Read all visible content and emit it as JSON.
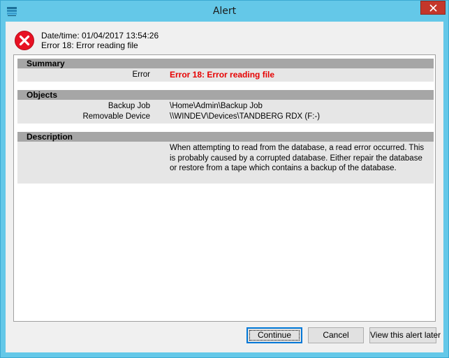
{
  "window": {
    "title": "Alert"
  },
  "icons": {
    "app": "app-icon",
    "close": "close-icon",
    "error": "error-icon"
  },
  "colors": {
    "titlebar": "#64c8e8",
    "close_button": "#c4372b",
    "error_red": "#e60000",
    "section_header": "#a6a6a6",
    "section_body": "#e6e6e6"
  },
  "header": {
    "datetime_line": "Date/time: 01/04/2017 13:54:26",
    "error_line": "Error 18: Error reading file"
  },
  "summary": {
    "title": "Summary",
    "rows": [
      {
        "label": "Error",
        "value": "Error 18: Error reading file"
      }
    ]
  },
  "objects": {
    "title": "Objects",
    "rows": [
      {
        "label": "Backup Job",
        "value": "\\Home\\Admin\\Backup Job"
      },
      {
        "label": "Removable Device",
        "value": "\\\\WINDEV\\Devices\\TANDBERG RDX (F:-)"
      }
    ]
  },
  "description": {
    "title": "Description",
    "text": "When attempting to read from the database, a read error occurred. This is probably caused by a corrupted database. Either repair the database or restore from a tape which contains a backup of the database."
  },
  "buttons": {
    "continue": "Continue",
    "cancel": "Cancel",
    "view_later": "View this alert later"
  }
}
